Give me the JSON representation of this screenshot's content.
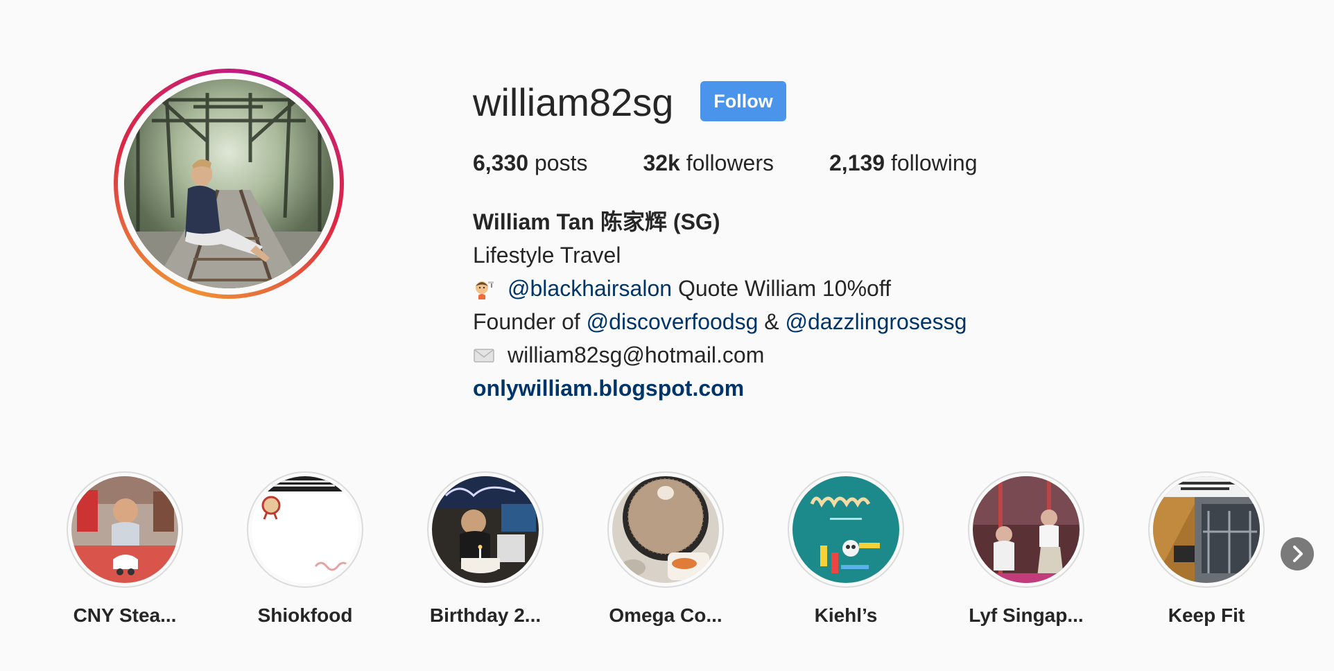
{
  "profile": {
    "username": "william82sg",
    "follow_label": "Follow",
    "stats": {
      "posts_count": "6,330",
      "posts_label": "posts",
      "followers_count": "32k",
      "followers_label": "followers",
      "following_count": "2,139",
      "following_label": "following"
    },
    "bio": {
      "name": "William Tan 陈家辉 (SG)",
      "category": "Lifestyle Travel",
      "line1_mention": "@blackhairsalon",
      "line1_text": " Quote William 10%off",
      "line2_prefix": "Founder of ",
      "line2_mention1": "@discoverfoodsg",
      "line2_amp": " & ",
      "line2_mention2": "@dazzlingrosessg",
      "email": "william82sg@hotmail.com",
      "website": "onlywilliam.blogspot.com"
    }
  },
  "highlights": [
    {
      "label": "CNY Stea...",
      "icon": "cny-steamboat-cover"
    },
    {
      "label": "Shiokfood",
      "icon": "shiokfood-cover"
    },
    {
      "label": "Birthday 2...",
      "icon": "birthday-cover"
    },
    {
      "label": "Omega Co...",
      "icon": "omega-coffee-cover"
    },
    {
      "label": "Kiehl’s",
      "icon": "kiehls-cover"
    },
    {
      "label": "Lyf Singap...",
      "icon": "lyf-singapore-cover"
    },
    {
      "label": "Keep Fit",
      "icon": "keep-fit-cover"
    }
  ],
  "colors": {
    "follow_button": "#4b94ec",
    "mention": "#003569",
    "background": "#fafafa"
  }
}
